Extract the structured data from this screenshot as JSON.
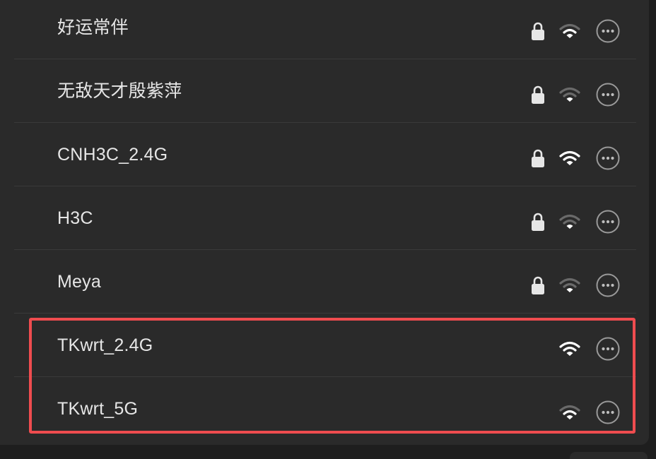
{
  "networks": [
    {
      "name": "好运常伴",
      "locked": true,
      "signal": "medium",
      "more_icon": "more-options-icon"
    },
    {
      "name": "无敌天才殷紫萍",
      "locked": true,
      "signal": "weak",
      "more_icon": "more-options-icon"
    },
    {
      "name": "CNH3C_2.4G",
      "locked": true,
      "signal": "strong",
      "more_icon": "more-options-icon"
    },
    {
      "name": "H3C",
      "locked": true,
      "signal": "weak",
      "more_icon": "more-options-icon"
    },
    {
      "name": "Meya",
      "locked": true,
      "signal": "weak",
      "more_icon": "more-options-icon"
    },
    {
      "name": "TKwrt_2.4G",
      "locked": false,
      "signal": "strong",
      "more_icon": "more-options-icon"
    },
    {
      "name": "TKwrt_5G",
      "locked": false,
      "signal": "medium",
      "more_icon": "more-options-icon"
    }
  ],
  "highlight": {
    "color": "#ef4c4f",
    "rows": [
      "TKwrt_2.4G",
      "TKwrt_5G"
    ]
  },
  "colors": {
    "background": "#2a2a2a",
    "text": "#e6e6e6",
    "icon_active": "#ffffff",
    "icon_dim": "#6a6a6a",
    "separator": "#3a3a3a"
  }
}
